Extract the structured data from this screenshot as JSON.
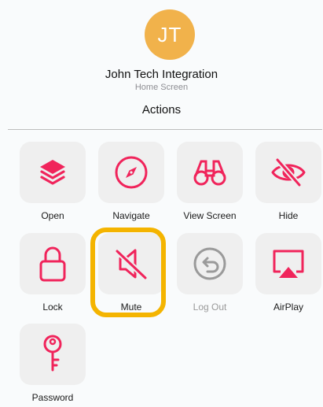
{
  "contact": {
    "initials": "JT",
    "name": "John Tech Integration",
    "subtitle": "Home Screen"
  },
  "section": {
    "title": "Actions"
  },
  "colors": {
    "accent": "#f0245b",
    "avatar": "#f1b24b",
    "disabled": "#9a9a9a",
    "highlight": "#f4b400"
  },
  "actions": [
    {
      "label": "Open",
      "icon": "layers-icon",
      "enabled": true
    },
    {
      "label": "Navigate",
      "icon": "compass-icon",
      "enabled": true
    },
    {
      "label": "View Screen",
      "icon": "binoculars-icon",
      "enabled": true
    },
    {
      "label": "Hide",
      "icon": "eye-slash-icon",
      "enabled": true
    },
    {
      "label": "Lock",
      "icon": "lock-icon",
      "enabled": true
    },
    {
      "label": "Mute",
      "icon": "speaker-slash-icon",
      "enabled": true,
      "highlighted": true
    },
    {
      "label": "Log Out",
      "icon": "logout-icon",
      "enabled": false
    },
    {
      "label": "AirPlay",
      "icon": "airplay-icon",
      "enabled": true
    },
    {
      "label": "Password",
      "icon": "key-icon",
      "enabled": true
    }
  ]
}
